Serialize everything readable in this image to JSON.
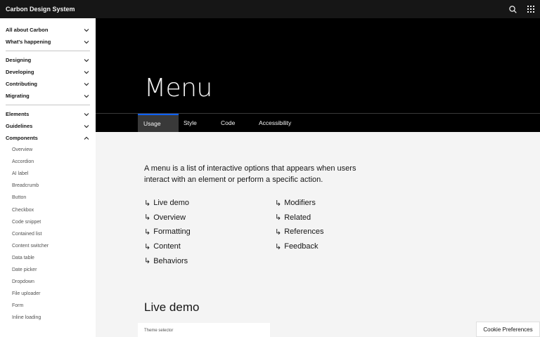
{
  "header": {
    "brand": "Carbon Design System",
    "search_icon": "search-icon",
    "switcher_icon": "app-switcher-icon"
  },
  "sidebar": {
    "groups": [
      [
        {
          "label": "All about Carbon",
          "expanded": false
        },
        {
          "label": "What's happening",
          "expanded": false
        }
      ],
      [
        {
          "label": "Designing",
          "expanded": false
        },
        {
          "label": "Developing",
          "expanded": false
        },
        {
          "label": "Contributing",
          "expanded": false
        },
        {
          "label": "Migrating",
          "expanded": false
        }
      ],
      [
        {
          "label": "Elements",
          "expanded": false
        },
        {
          "label": "Guidelines",
          "expanded": false
        },
        {
          "label": "Components",
          "expanded": true
        }
      ]
    ],
    "components": [
      "Overview",
      "Accordion",
      "AI label",
      "Breadcrumb",
      "Button",
      "Checkbox",
      "Code snippet",
      "Contained list",
      "Content switcher",
      "Data table",
      "Date picker",
      "Dropdown",
      "File uploader",
      "Form",
      "Inline loading"
    ]
  },
  "page": {
    "title": "Menu",
    "tabs": [
      {
        "label": "Usage",
        "active": true
      },
      {
        "label": "Style",
        "active": false
      },
      {
        "label": "Code",
        "active": false
      },
      {
        "label": "Accessibility",
        "active": false
      }
    ],
    "lead": "A menu is a list of interactive options that appears when users interact with an element or perform a specific action.",
    "anchor_arrow": "↳",
    "anchors_left": [
      "Live demo",
      "Overview",
      "Formatting",
      "Content",
      "Behaviors"
    ],
    "anchors_right": [
      "Modifiers",
      "Related",
      "References",
      "Feedback"
    ],
    "section_title": "Live demo",
    "demo_label": "Theme selector"
  },
  "cookie": {
    "label": "Cookie Preferences"
  },
  "colors": {
    "accent": "#0f62fe",
    "header": "#161616",
    "hero": "#000000",
    "page_bg": "#f4f4f4"
  }
}
